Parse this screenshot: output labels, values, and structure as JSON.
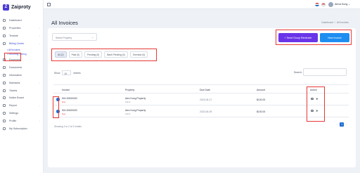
{
  "brand": {
    "name": "Zaiproty"
  },
  "sidebar": {
    "items": [
      {
        "label": "Dashboard"
      },
      {
        "label": "Properties",
        "chev": "›"
      },
      {
        "label": "Tenants",
        "chev": "›"
      },
      {
        "label": "Billing Center",
        "chev": "›"
      },
      {
        "label": "Expenses"
      },
      {
        "label": "Documents"
      },
      {
        "label": "Information"
      },
      {
        "label": "Maintains",
        "chev": "›"
      },
      {
        "label": "Tickets"
      },
      {
        "label": "Notice Board"
      },
      {
        "label": "Report",
        "chev": "›"
      },
      {
        "label": "Settings"
      },
      {
        "label": "Profile",
        "chev": "›"
      },
      {
        "label": "My Subscription"
      }
    ],
    "billing_sub": [
      {
        "label": "• All Invoices"
      },
      {
        "label": "• Recurring Setting"
      }
    ]
  },
  "topbar": {
    "user_name": "Alexa Kung"
  },
  "page": {
    "title": "All Invoices",
    "breadcrumb": [
      "Dashboard",
      "All Invoices"
    ],
    "breadcrumb_sep": "/"
  },
  "filters": {
    "property_placeholder": "Select Property",
    "chevron": "⌄"
  },
  "buttons": {
    "reminder": "+ Send Group Reminder",
    "new_invoice": "New Invoice"
  },
  "tabs": [
    {
      "label": "All (2)"
    },
    {
      "label": "Paid (0)"
    },
    {
      "label": "Pending (0)"
    },
    {
      "label": "Bank Pending (0)"
    },
    {
      "label": "Overdue (0)"
    }
  ],
  "table_controls": {
    "show": "Show",
    "entries_value": "10",
    "entries": "entries",
    "search": "Search:"
  },
  "table": {
    "headers": [
      "Invoice",
      "Property",
      "Due Date",
      "Amount",
      "Action"
    ],
    "rows": [
      {
        "invoice": "INV-00000000",
        "badge": "Due",
        "property": "Alex Kung Property",
        "unit": "Unit 4",
        "due": "2023-05-17",
        "amount": "$100.00"
      },
      {
        "invoice": "INV-00000000",
        "badge": "Due",
        "property": "Alex Kung Property",
        "unit": "Unit 4",
        "due": "2023-06-09",
        "amount": "$100.00"
      }
    ]
  },
  "footer": {
    "showing": "Showing 1 to 2 of 2 entries",
    "page": "1",
    "prev": "‹",
    "next": "›"
  },
  "icons": {
    "send": "➤"
  }
}
